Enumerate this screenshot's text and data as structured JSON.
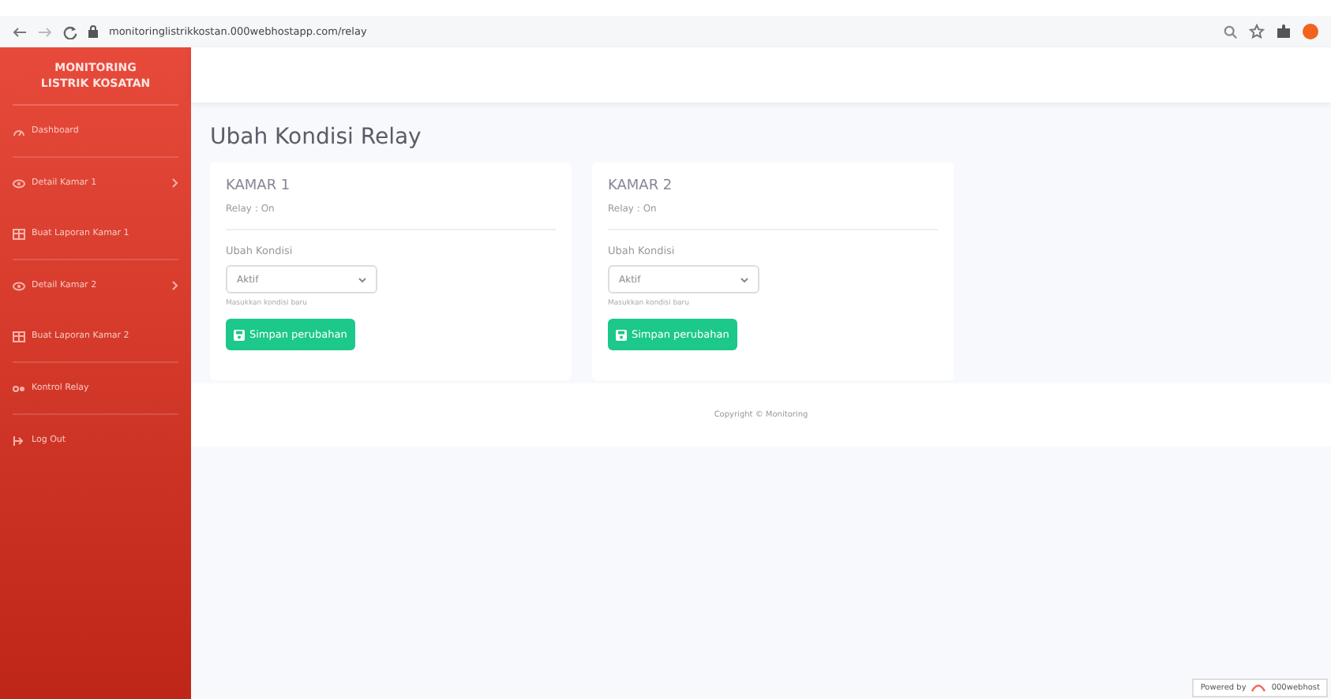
{
  "browser": {
    "url": "monitoringlistrikkostan.000webhostapp.com/relay"
  },
  "sidebar": {
    "brand": [
      "MONITORING",
      "LISTRIK KOSATAN"
    ],
    "items": [
      {
        "label": "Dashboard",
        "kind": "gauge",
        "submenu": false,
        "divider": true
      },
      {
        "label": "Detail Kamar 1",
        "kind": "eye",
        "submenu": true,
        "divider": false
      },
      {
        "label": "Buat Laporan Kamar 1",
        "kind": "table",
        "submenu": false,
        "divider": true
      },
      {
        "label": "Detail Kamar 2",
        "kind": "eye",
        "submenu": true,
        "divider": false
      },
      {
        "label": "Buat Laporan Kamar 2",
        "kind": "table",
        "submenu": false,
        "divider": true
      },
      {
        "label": "Kontrol Relay",
        "kind": "toggle",
        "submenu": false,
        "divider": true
      },
      {
        "label": "Log Out",
        "kind": "logout",
        "submenu": false,
        "divider": false
      }
    ]
  },
  "page_title": "Ubah Kondisi Relay",
  "cards": [
    {
      "title": "KAMAR 1",
      "status": "Relay : On",
      "field_label": "Ubah Kondisi",
      "value": "Aktif",
      "help": "Masukkan kondisi baru",
      "button": "Simpan perubahan"
    },
    {
      "title": "KAMAR 2",
      "status": "Relay : On",
      "field_label": "Ubah Kondisi",
      "value": "Aktif",
      "help": "Masukkan kondisi baru",
      "button": "Simpan perubahan"
    }
  ],
  "footer": "Copyright © Monitoring",
  "badge": {
    "prefix": "Powered by",
    "brand": "000webhost"
  }
}
